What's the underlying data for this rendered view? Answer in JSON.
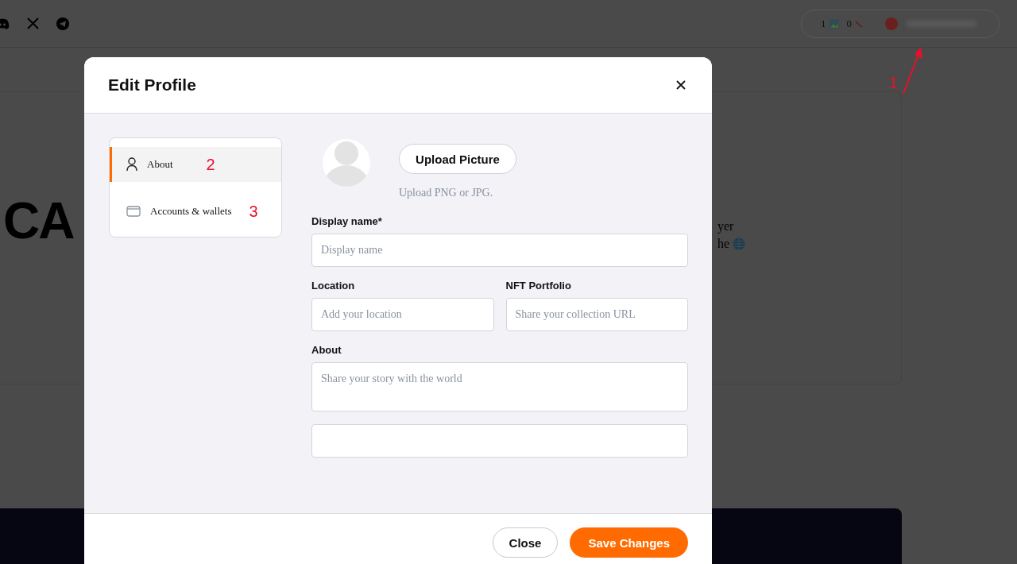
{
  "background": {
    "stats": [
      "1",
      "0"
    ],
    "hero_text": "CA",
    "text_fragments": [
      "yer",
      "he"
    ]
  },
  "modal": {
    "title": "Edit Profile",
    "nav": [
      {
        "label": "About",
        "selected": true,
        "marker": "2",
        "kind": "person"
      },
      {
        "label": "Accounts & wallets",
        "selected": false,
        "marker": "3",
        "kind": "wallet"
      }
    ],
    "upload_button": "Upload Picture",
    "upload_hint": "Upload PNG or JPG.",
    "field_rows": [
      [
        {
          "label": "Display name*",
          "placeholder": "Display name",
          "kind": "input"
        }
      ],
      [
        {
          "label": "Location",
          "placeholder": "Add your location",
          "kind": "input"
        },
        {
          "label": "NFT Portfolio",
          "placeholder": "Share your collection URL",
          "kind": "input"
        }
      ],
      [
        {
          "label": "About",
          "placeholder": "Share your story with the world",
          "kind": "textarea"
        }
      ],
      [
        {
          "kind": "input"
        }
      ]
    ],
    "buttons": [
      {
        "label": "Close",
        "kind": "secondary"
      },
      {
        "label": "Save Changes",
        "kind": "primary"
      }
    ]
  },
  "annotation": {
    "label": "1"
  }
}
